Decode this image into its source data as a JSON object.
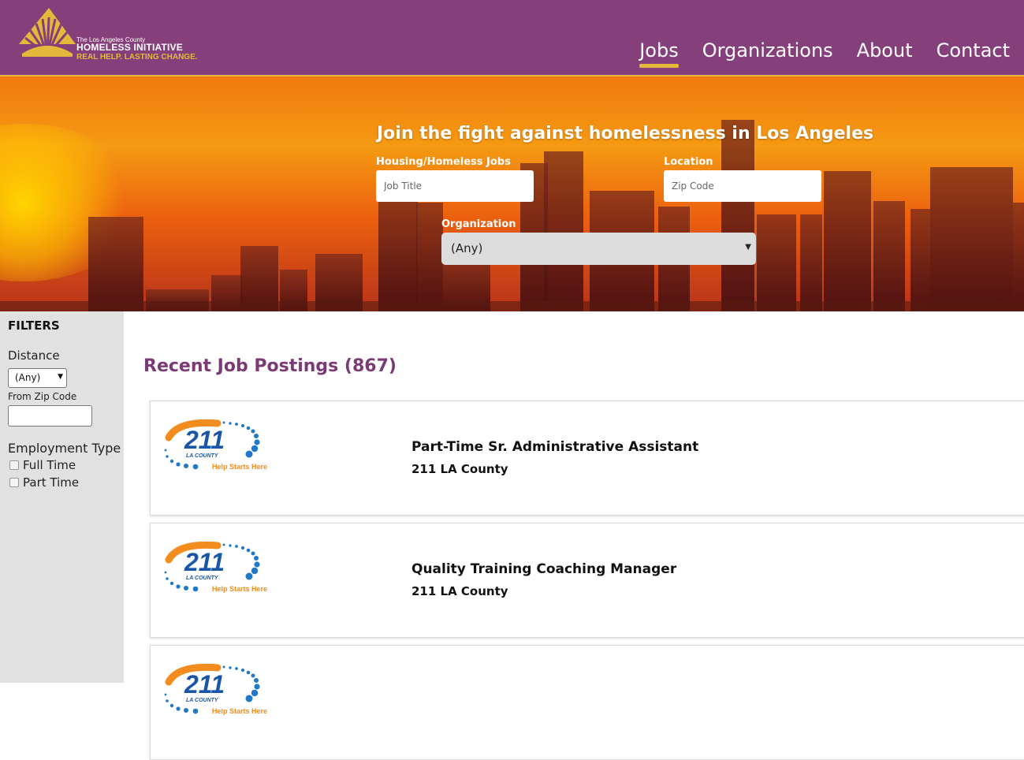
{
  "header": {
    "logo_line1": "The Los Angeles County",
    "logo_line2": "HOMELESS INITIATIVE",
    "logo_tagline": "REAL HELP. LASTING CHANGE.",
    "nav": [
      {
        "label": "Jobs",
        "active": true
      },
      {
        "label": "Organizations",
        "active": false
      },
      {
        "label": "About",
        "active": false
      },
      {
        "label": "Contact",
        "active": false
      }
    ]
  },
  "hero": {
    "title": "Join the fight against homelessness in Los Angeles",
    "jobs_label": "Housing/Homeless Jobs",
    "jobs_placeholder": "Job Title",
    "location_label": "Location",
    "location_placeholder": "Zip Code",
    "org_label": "Organization",
    "org_selected": "(Any)"
  },
  "sidebar": {
    "title": "FILTERS",
    "distance_label": "Distance",
    "distance_selected": "(Any)",
    "zip_label": "From Zip Code",
    "zip_value": "",
    "employment_label": "Employment Type",
    "employment_options": [
      {
        "label": "Full Time",
        "checked": false
      },
      {
        "label": "Part Time",
        "checked": false
      }
    ]
  },
  "main": {
    "title": "Recent Job Postings (867)",
    "jobs": [
      {
        "title": "Part-Time Sr. Administrative Assistant",
        "org": "211 LA County",
        "logo_text": "211",
        "logo_sub": "LA COUNTY",
        "logo_tag": "Help Starts Here"
      },
      {
        "title": "Quality Training Coaching Manager",
        "org": "211 LA County",
        "logo_text": "211",
        "logo_sub": "LA COUNTY",
        "logo_tag": "Help Starts Here"
      },
      {
        "title": "",
        "org": "",
        "logo_text": "211",
        "logo_sub": "LA COUNTY",
        "logo_tag": "Help Starts Here"
      }
    ]
  },
  "colors": {
    "brand_purple": "#853f7a",
    "accent_gold": "#e4b83b",
    "heading_purple": "#7b3a75"
  }
}
